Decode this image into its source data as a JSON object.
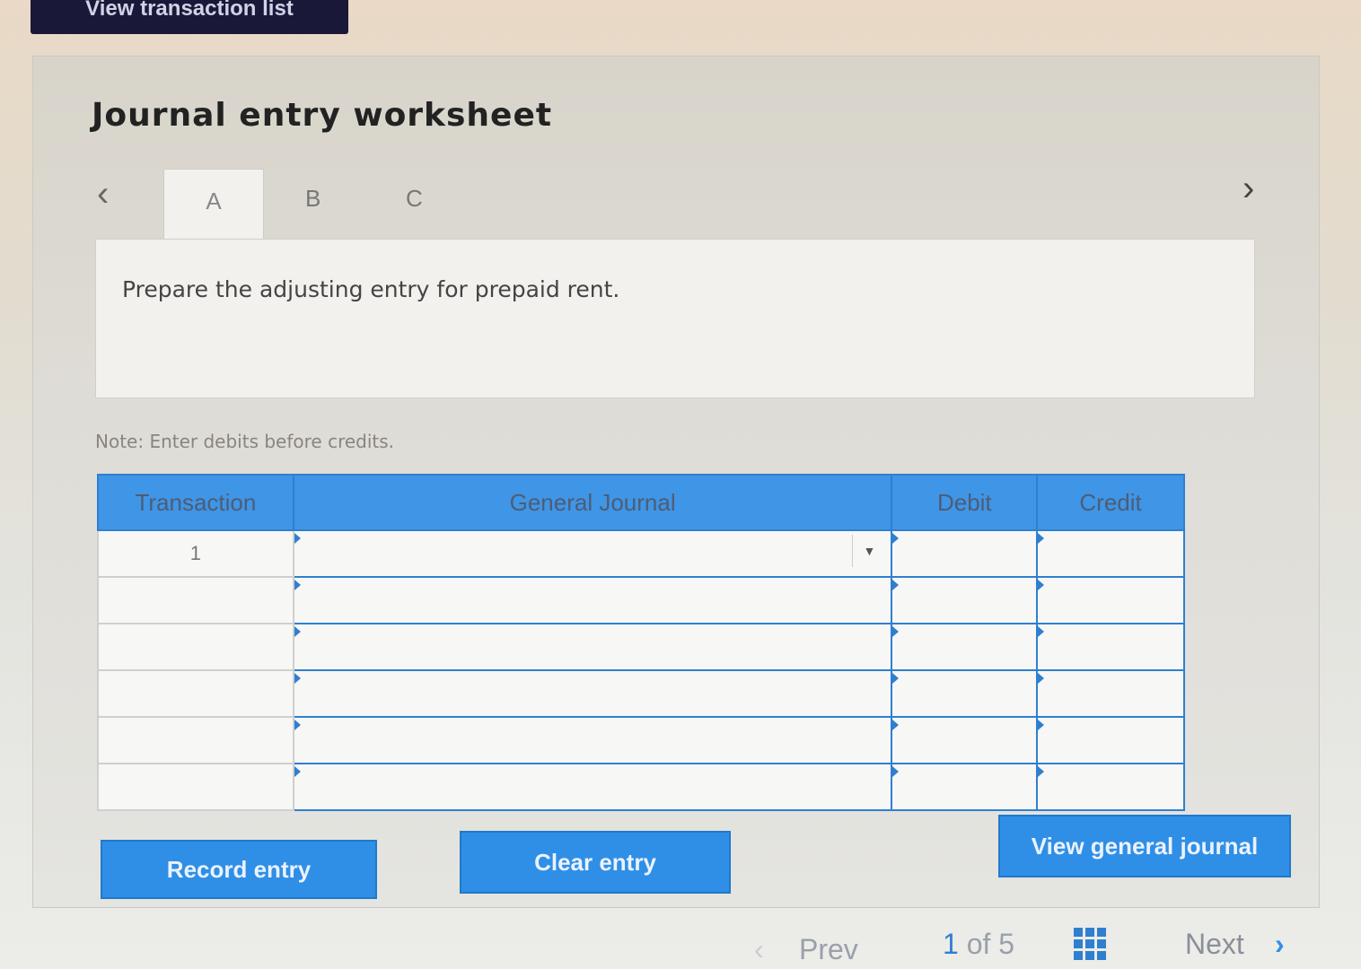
{
  "top_button": {
    "label": "View transaction list"
  },
  "worksheet": {
    "title": "Journal entry worksheet",
    "tabs": [
      {
        "label": "A"
      },
      {
        "label": "B"
      },
      {
        "label": "C"
      }
    ],
    "prompt": "Prepare the adjusting entry for prepaid rent.",
    "note": "Note: Enter debits before credits."
  },
  "table": {
    "headers": {
      "transaction": "Transaction",
      "journal": "General Journal",
      "debit": "Debit",
      "credit": "Credit"
    },
    "rows": [
      {
        "transaction": "1",
        "journal": "",
        "debit": "",
        "credit": ""
      },
      {
        "transaction": "",
        "journal": "",
        "debit": "",
        "credit": ""
      },
      {
        "transaction": "",
        "journal": "",
        "debit": "",
        "credit": ""
      },
      {
        "transaction": "",
        "journal": "",
        "debit": "",
        "credit": ""
      },
      {
        "transaction": "",
        "journal": "",
        "debit": "",
        "credit": ""
      },
      {
        "transaction": "",
        "journal": "",
        "debit": "",
        "credit": ""
      }
    ]
  },
  "buttons": {
    "record": "Record entry",
    "clear": "Clear entry",
    "view_journal": "View general journal"
  },
  "footer": {
    "prev": "Prev",
    "page_current": "1",
    "page_of": "of",
    "page_total": "5",
    "next": "Next"
  },
  "colors": {
    "accent": "#2f8fe6",
    "header_bg": "#3f95e6",
    "dark_button": "#1a1838"
  },
  "icons": {
    "left": "chevron-left-icon",
    "right": "chevron-right-icon",
    "grid": "grid-icon",
    "dropdown": "caret-down-icon"
  }
}
